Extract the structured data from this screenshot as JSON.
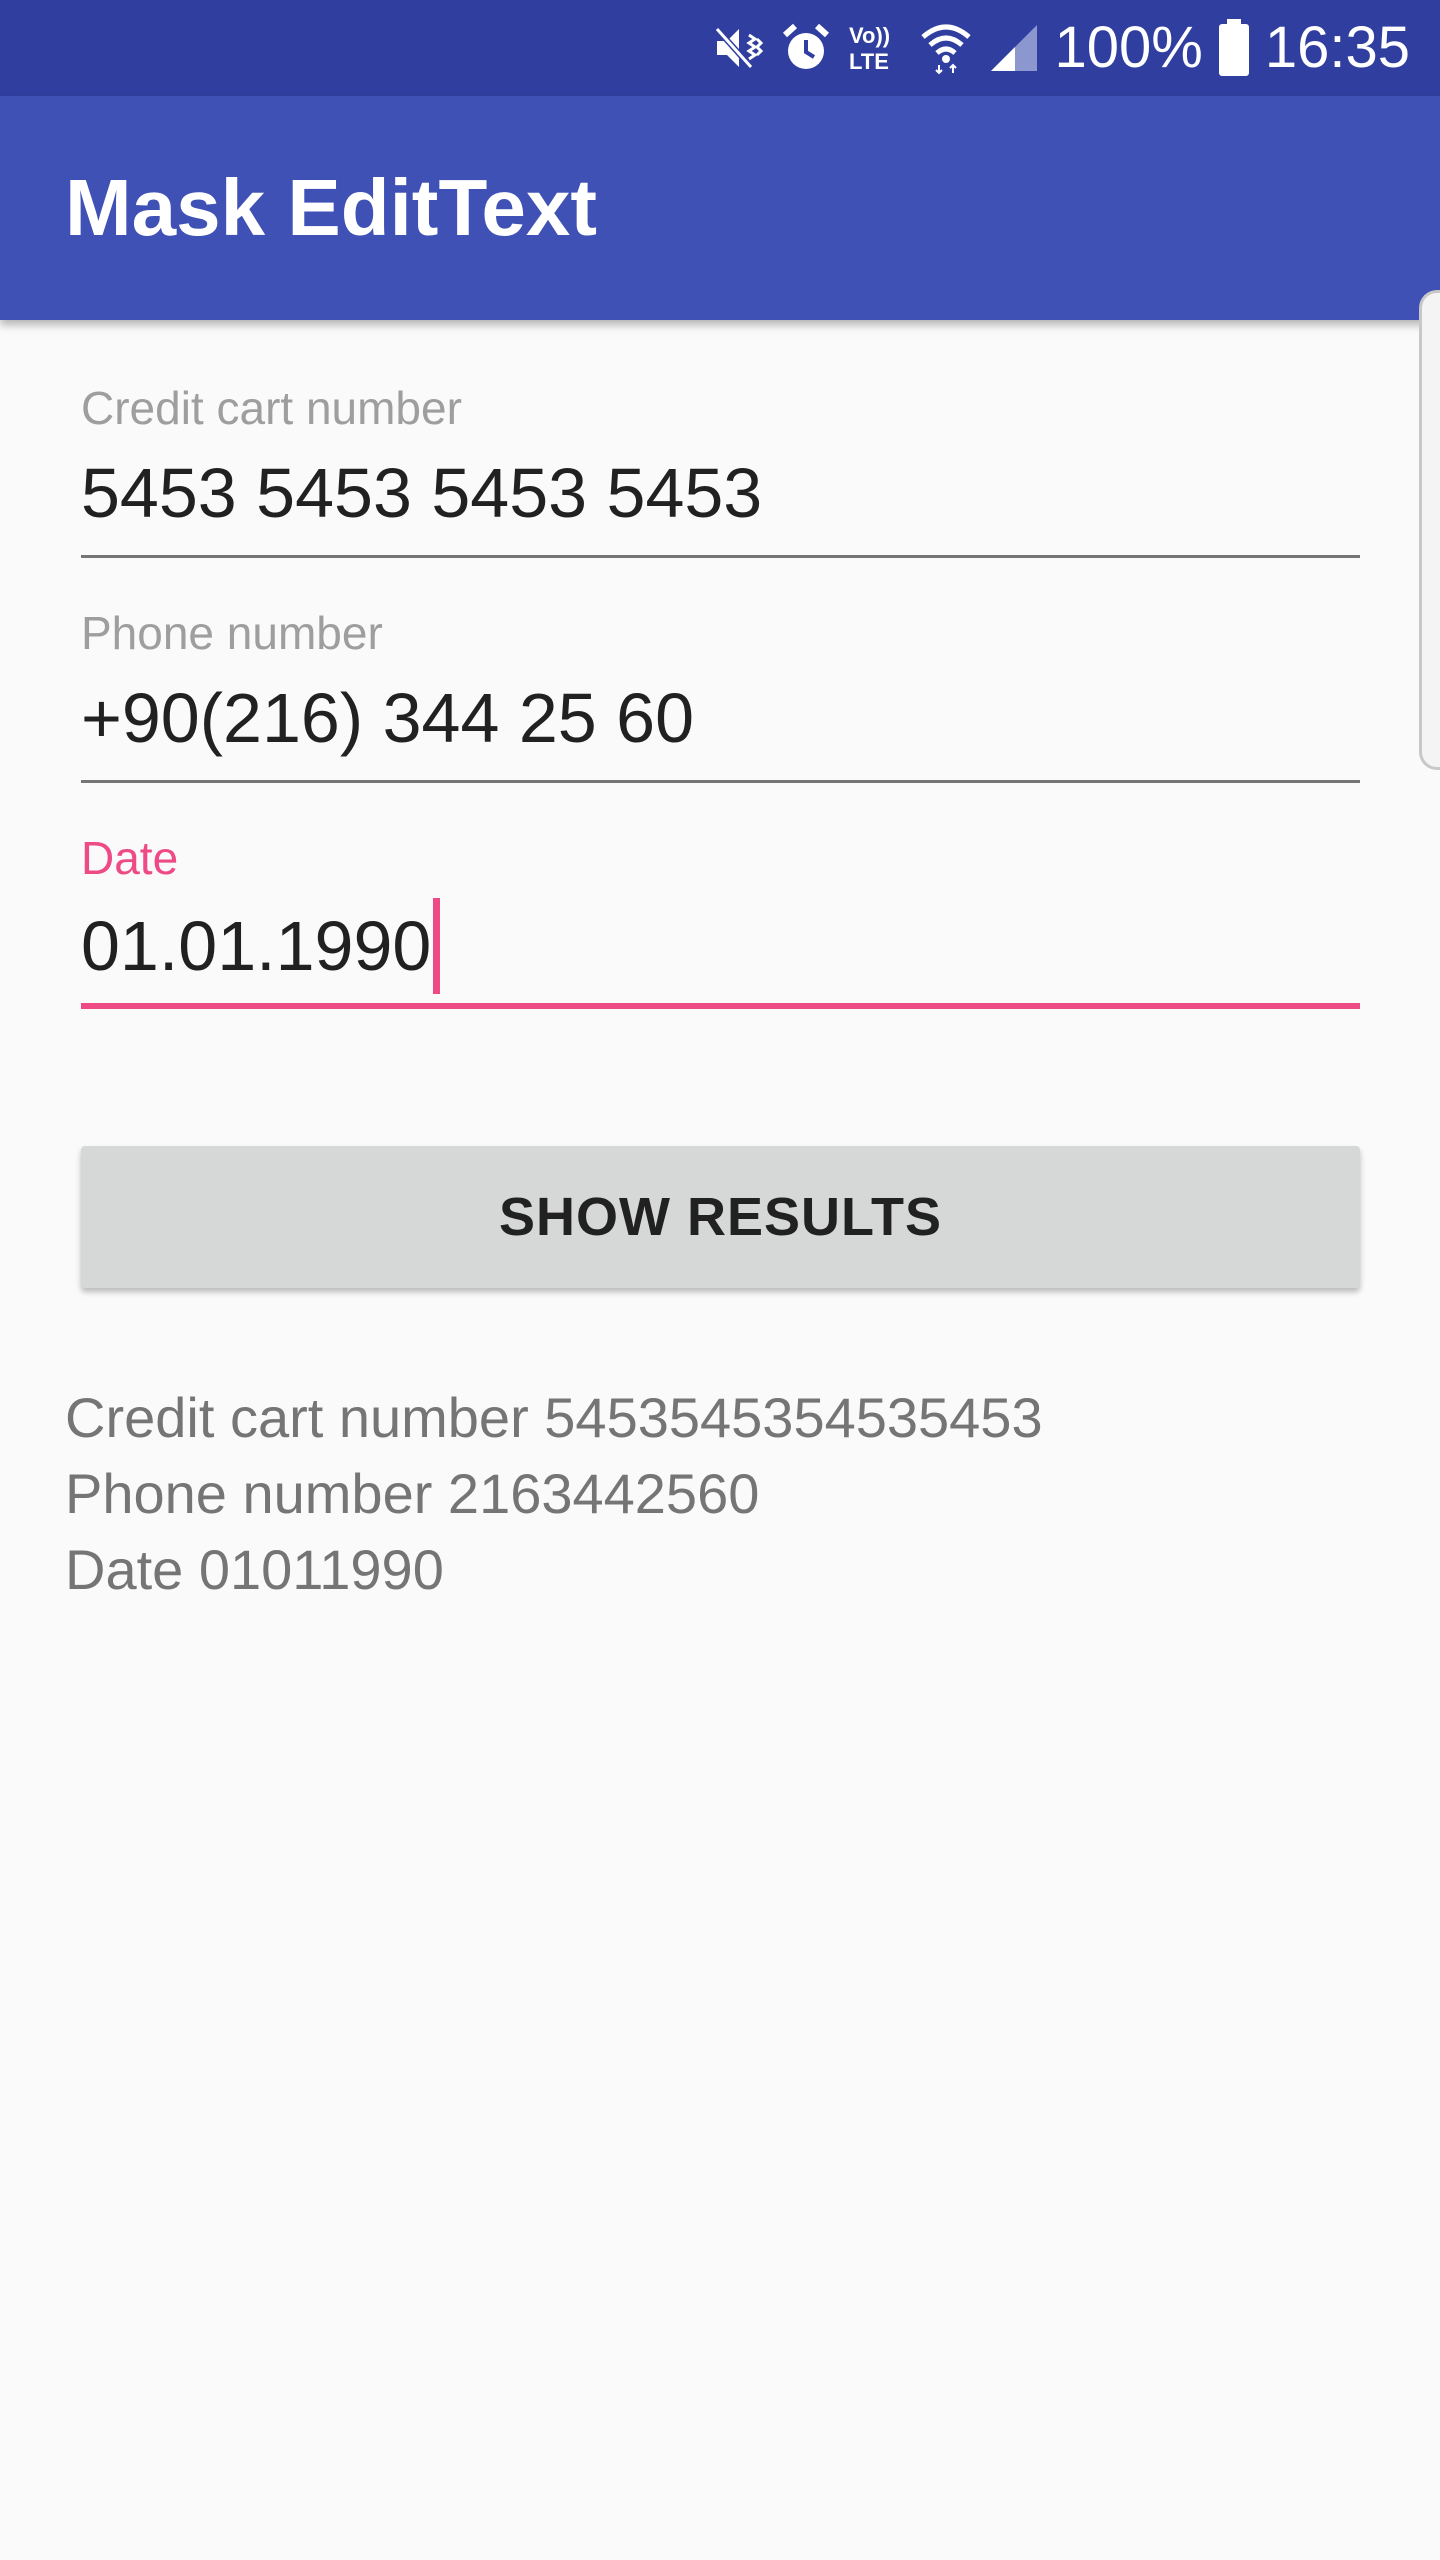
{
  "status_bar": {
    "battery_text": "100%",
    "time": "16:35",
    "volte_label_top": "Vo))",
    "volte_label_bottom": "LTE",
    "icons": [
      "mute-vibrate-icon",
      "alarm-icon",
      "volte-icon",
      "wifi-icon",
      "signal-icon",
      "battery-icon"
    ]
  },
  "app_bar": {
    "title": "Mask EditText"
  },
  "form": {
    "credit_card": {
      "label": "Credit cart number",
      "value": "5453 5453 5453 5453"
    },
    "phone": {
      "label": "Phone number",
      "value": "+90(216) 344 25 60"
    },
    "date": {
      "label": "Date",
      "value": "01.01.1990"
    }
  },
  "button": {
    "label": "SHOW RESULTS"
  },
  "results": {
    "credit_card": "Credit cart number 5453545354535453",
    "phone": "Phone number 2163442560",
    "date": "Date 01011990"
  },
  "colors": {
    "status_bar": "#303f9f",
    "app_bar": "#3f51b5",
    "accent": "#ee4a86",
    "background": "#fafafa",
    "button": "#d6d7d7"
  }
}
